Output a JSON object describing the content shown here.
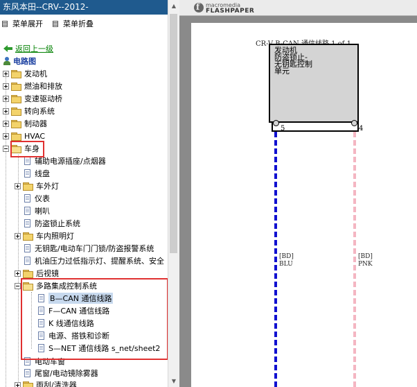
{
  "app": {
    "title": "东风本田--CRV--2012-"
  },
  "toolbar": {
    "expand_label": "菜单展开",
    "collapse_label": "菜单折叠"
  },
  "tree": {
    "back_label": "返回上一级",
    "root_label": "电路图",
    "items": [
      {
        "label": "发动机"
      },
      {
        "label": "燃油和排放"
      },
      {
        "label": "变速驱动桥"
      },
      {
        "label": "转向系统"
      },
      {
        "label": "制动器"
      },
      {
        "label": "HVAC"
      },
      {
        "label": "车身",
        "children": [
          {
            "label": "辅助电源插座/点烟器"
          },
          {
            "label": "线盘"
          },
          {
            "label": "车外灯"
          },
          {
            "label": "仪表"
          },
          {
            "label": "喇叭"
          },
          {
            "label": "防盗锁止系统"
          },
          {
            "label": "车内照明灯"
          },
          {
            "label": "无钥匙/电动车门门锁/防盗报警系统"
          },
          {
            "label": "机油压力过低指示灯、提醒系统、安全"
          },
          {
            "label": "后视镜"
          },
          {
            "label": "多路集成控制系统",
            "children": [
              {
                "label": "B—CAN 通信线路",
                "selected": true
              },
              {
                "label": "F—CAN 通信线路"
              },
              {
                "label": "K 线通信线路"
              },
              {
                "label": "电源、搭铁和诊断"
              },
              {
                "label": "S—NET 通信线路 s_net/sheet2"
              }
            ]
          },
          {
            "label": "电动车窗"
          },
          {
            "label": "尾窗/电动镜除雾器"
          },
          {
            "label": "雨刮/清洗器"
          }
        ]
      }
    ]
  },
  "viewer": {
    "brand_top": "macromedia",
    "brand_bottom": "FLASHPAPER",
    "diagram": {
      "title": "CR-V  B-CAN  通信线路 1 of 1",
      "module_lines": [
        "发动机",
        "防盗锁止-",
        "无钥匙控制",
        "单元"
      ],
      "pins": [
        {
          "number": "5",
          "code": "[BD]",
          "color_label": "BLU",
          "color": "#1010d0"
        },
        {
          "number": "4",
          "code": "[BD]",
          "color_label": "PNK",
          "color": "#f4b6c2"
        }
      ]
    }
  },
  "colors": {
    "title_bar": "#1f5a8e",
    "annotation_red": "#e03030",
    "selection": "#c7d9ee"
  }
}
